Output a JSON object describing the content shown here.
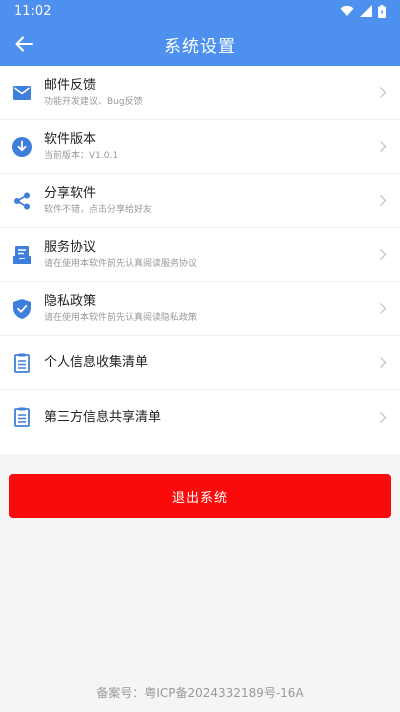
{
  "status_bar": {
    "time": "11:02"
  },
  "header": {
    "title": "系统设置"
  },
  "menu": [
    {
      "icon": "mail-icon",
      "title": "邮件反馈",
      "subtitle": "功能开发建议、Bug反馈"
    },
    {
      "icon": "download-circle-icon",
      "title": "软件版本",
      "subtitle": "当前版本：V1.0.1"
    },
    {
      "icon": "share-icon",
      "title": "分享软件",
      "subtitle": "软件不错，点击分享给好友"
    },
    {
      "icon": "agreement-icon",
      "title": "服务协议",
      "subtitle": "请在使用本软件前先认真阅读服务协议"
    },
    {
      "icon": "shield-check-icon",
      "title": "隐私政策",
      "subtitle": "请在使用本软件前先认真阅读隐私政策"
    },
    {
      "icon": "clipboard-list-icon",
      "title": "个人信息收集清单"
    },
    {
      "icon": "clipboard-list-icon",
      "title": "第三方信息共享清单"
    }
  ],
  "logout_label": "退出系统",
  "footer": {
    "icp": "备案号：粤ICP备2024332189号-16A"
  },
  "colors": {
    "primary": "#4d90ee",
    "danger": "#fa0a0a",
    "icon_blue": "#3f7fdc"
  }
}
